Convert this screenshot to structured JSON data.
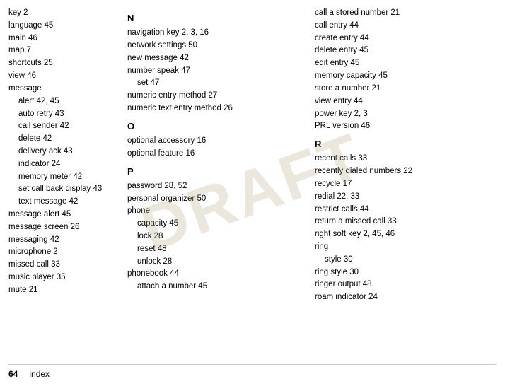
{
  "watermark": "DRAFT",
  "footer": {
    "page_number": "64",
    "label": "index"
  },
  "columns": [
    {
      "id": "col1",
      "entries": [
        {
          "text": "key  2",
          "indent": 0
        },
        {
          "text": "language  45",
          "indent": 0
        },
        {
          "text": "main  46",
          "indent": 0
        },
        {
          "text": "map  7",
          "indent": 0
        },
        {
          "text": "shortcuts  25",
          "indent": 0
        },
        {
          "text": "view  46",
          "indent": 0
        },
        {
          "text": "message",
          "indent": 0
        },
        {
          "text": "alert  42, 45",
          "indent": 1
        },
        {
          "text": "auto retry  43",
          "indent": 1
        },
        {
          "text": "call sender  42",
          "indent": 1
        },
        {
          "text": "delete  42",
          "indent": 1
        },
        {
          "text": "delivery ack  43",
          "indent": 1
        },
        {
          "text": "indicator  24",
          "indent": 1
        },
        {
          "text": "memory meter  42",
          "indent": 1
        },
        {
          "text": "set call back display  43",
          "indent": 1
        },
        {
          "text": "text message  42",
          "indent": 1
        },
        {
          "text": "message alert  45",
          "indent": 0
        },
        {
          "text": "message screen  26",
          "indent": 0
        },
        {
          "text": "messaging  42",
          "indent": 0
        },
        {
          "text": "microphone  2",
          "indent": 0
        },
        {
          "text": "missed call  33",
          "indent": 0
        },
        {
          "text": "music player  35",
          "indent": 0
        },
        {
          "text": "mute  21",
          "indent": 0
        }
      ]
    },
    {
      "id": "col2",
      "sections": [
        {
          "letter": "N",
          "entries": [
            {
              "text": "navigation key  2, 3, 16",
              "indent": 0
            },
            {
              "text": "network settings  50",
              "indent": 0
            },
            {
              "text": "new message  42",
              "indent": 0
            },
            {
              "text": "number speak  47",
              "indent": 0
            },
            {
              "text": "set  47",
              "indent": 1
            },
            {
              "text": "numeric entry method  27",
              "indent": 0
            },
            {
              "text": "numeric text entry method  26",
              "indent": 0
            }
          ]
        },
        {
          "letter": "O",
          "entries": [
            {
              "text": "optional accessory  16",
              "indent": 0
            },
            {
              "text": "optional feature  16",
              "indent": 0
            }
          ]
        },
        {
          "letter": "P",
          "entries": [
            {
              "text": "password  28, 52",
              "indent": 0
            },
            {
              "text": "personal organizer  50",
              "indent": 0
            },
            {
              "text": "phone",
              "indent": 0
            },
            {
              "text": "capacity  45",
              "indent": 1
            },
            {
              "text": "lock  28",
              "indent": 1
            },
            {
              "text": "reset  48",
              "indent": 1
            },
            {
              "text": "unlock  28",
              "indent": 1
            },
            {
              "text": "phonebook  44",
              "indent": 0
            },
            {
              "text": "attach a number  45",
              "indent": 1
            }
          ]
        }
      ]
    },
    {
      "id": "col3",
      "entries_top": [
        {
          "text": "call a stored number  21",
          "indent": 0
        },
        {
          "text": "call entry  44",
          "indent": 0
        },
        {
          "text": "create entry  44",
          "indent": 0
        },
        {
          "text": "delete entry  45",
          "indent": 0
        },
        {
          "text": "edit entry  45",
          "indent": 0
        },
        {
          "text": "memory capacity  45",
          "indent": 0
        },
        {
          "text": "store a number  21",
          "indent": 0
        },
        {
          "text": "view entry  44",
          "indent": 0
        },
        {
          "text": "power key  2, 3",
          "indent": 0
        },
        {
          "text": "PRL version  46",
          "indent": 0
        }
      ],
      "sections": [
        {
          "letter": "R",
          "entries": [
            {
              "text": "recent calls  33",
              "indent": 0
            },
            {
              "text": "recently dialed numbers  22",
              "indent": 0
            },
            {
              "text": "recycle  17",
              "indent": 0
            },
            {
              "text": "redial  22, 33",
              "indent": 0
            },
            {
              "text": "restrict calls  44",
              "indent": 0
            },
            {
              "text": "return a missed call  33",
              "indent": 0
            },
            {
              "text": "right soft key  2, 45, 46",
              "indent": 0
            },
            {
              "text": "ring",
              "indent": 0
            },
            {
              "text": "style  30",
              "indent": 1
            },
            {
              "text": "ring style  30",
              "indent": 0
            },
            {
              "text": "ringer output  48",
              "indent": 0
            },
            {
              "text": "roam indicator  24",
              "indent": 0
            }
          ]
        }
      ]
    }
  ]
}
